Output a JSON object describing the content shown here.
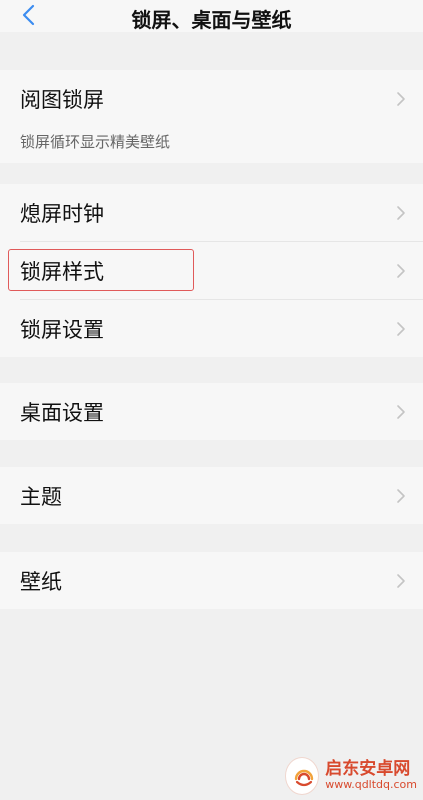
{
  "header": {
    "title": "锁屏、桌面与壁纸",
    "back_icon": "chevron-left-icon",
    "accent": "#3c8cf0"
  },
  "sections": {
    "s1": {
      "item": "阅图锁屏",
      "subtitle": "锁屏循环显示精美壁纸"
    },
    "s2": {
      "items": [
        "熄屏时钟",
        "锁屏样式",
        "锁屏设置"
      ]
    },
    "s3": {
      "item": "桌面设置"
    },
    "s4": {
      "item": "主题"
    },
    "s5": {
      "item": "壁纸"
    }
  },
  "highlight_color": "#e05a5a",
  "watermark": {
    "brand": "启东安卓网",
    "url": "www.qdltdq.com"
  }
}
